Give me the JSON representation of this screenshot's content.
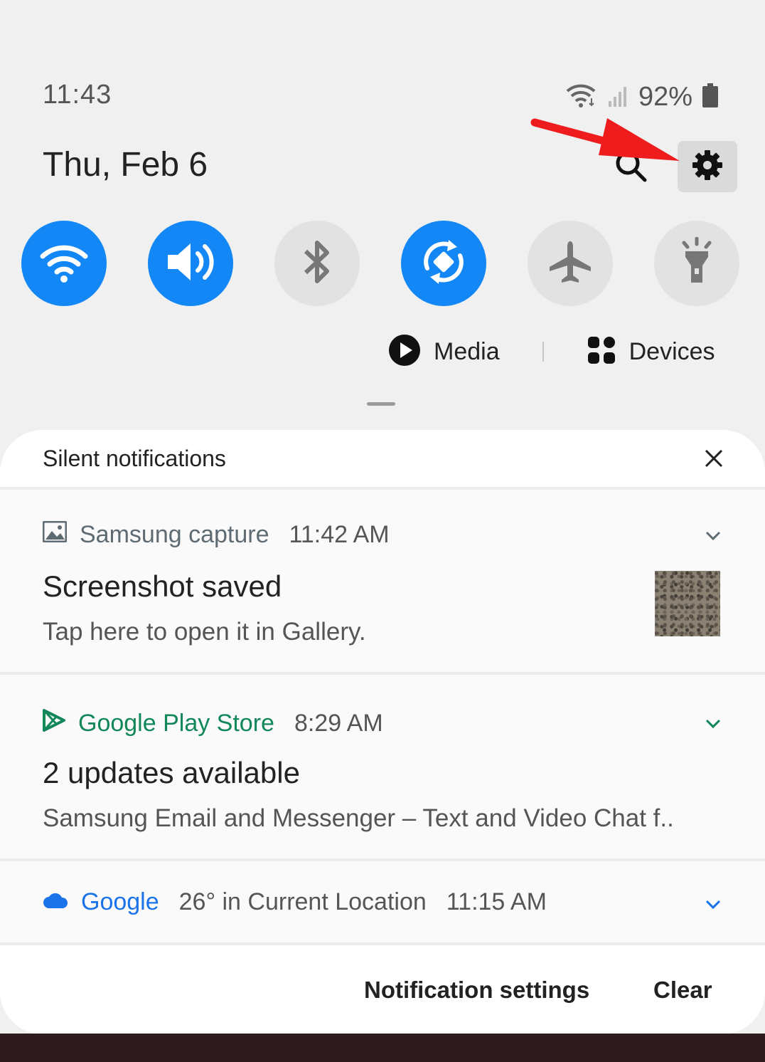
{
  "status_bar": {
    "time": "11:43",
    "battery": "92%"
  },
  "header": {
    "date": "Thu, Feb 6"
  },
  "quick_panel": {
    "toggles": [
      {
        "name": "wifi",
        "state": "on",
        "icon": "wifi-icon"
      },
      {
        "name": "sound",
        "state": "on",
        "icon": "volume-icon"
      },
      {
        "name": "bluetooth",
        "state": "off",
        "icon": "bluetooth-icon"
      },
      {
        "name": "auto-rotate",
        "state": "on",
        "icon": "rotate-icon"
      },
      {
        "name": "airplane-mode",
        "state": "off",
        "icon": "airplane-icon"
      },
      {
        "name": "flashlight",
        "state": "off",
        "icon": "flashlight-icon"
      }
    ],
    "media_label": "Media",
    "devices_label": "Devices"
  },
  "notifications": {
    "section_title": "Silent notifications",
    "items": [
      {
        "app": "Samsung capture",
        "time": "11:42 AM",
        "title": "Screenshot saved",
        "body": "Tap here to open it in Gallery.",
        "app_color": "#5f6b73"
      },
      {
        "app": "Google Play Store",
        "time": "8:29 AM",
        "title": "2 updates available",
        "body": "Samsung Email and Messenger – Text and Video Chat f..",
        "app_color": "#11875a"
      },
      {
        "app": "Google",
        "summary": "26° in Current Location",
        "time": "11:15 AM",
        "app_color": "#1a73e8"
      }
    ]
  },
  "footer": {
    "settings_label": "Notification settings",
    "clear_label": "Clear"
  },
  "colors": {
    "toggle_on": "#1287f5",
    "toggle_off": "#e2e2e2",
    "annotation_arrow": "#ee1c1c"
  }
}
